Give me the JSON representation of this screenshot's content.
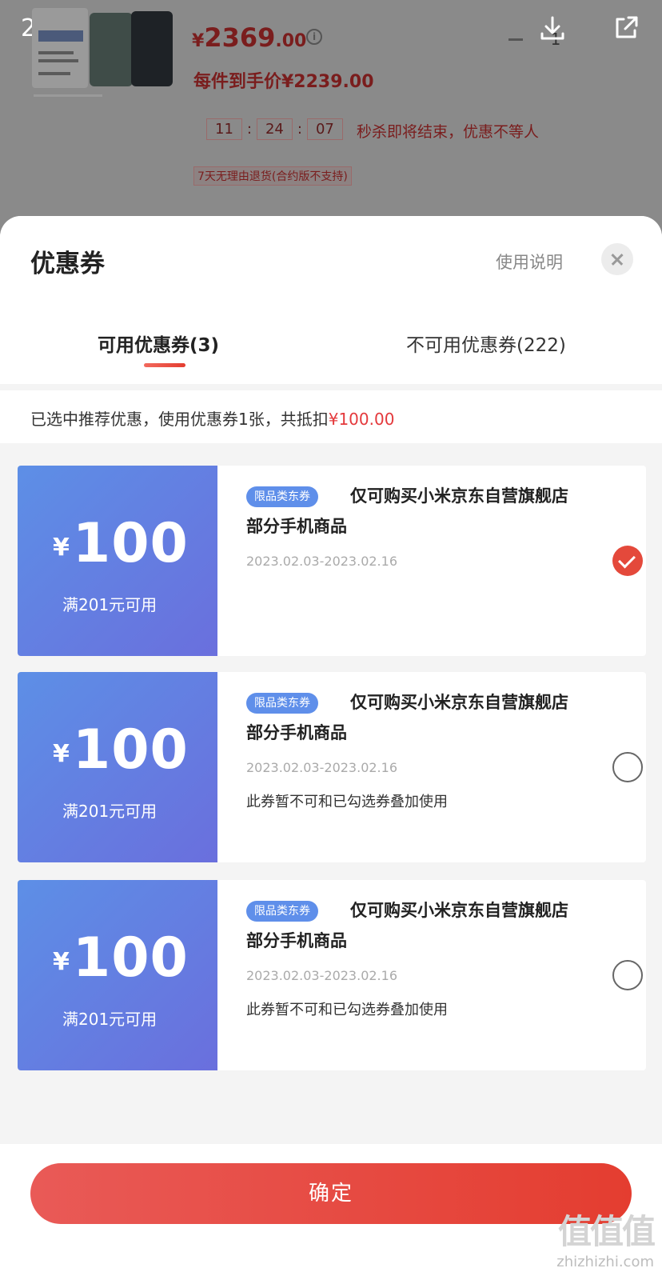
{
  "top": {
    "page_indicator": "2/2",
    "price_currency": "¥",
    "price_int": "2369",
    "price_dec": ".00",
    "info_icon": "info-icon",
    "quantity": "1",
    "unit_price": "每件到手价¥2239.00",
    "countdown": {
      "h": "11",
      "m": "24",
      "s": "07"
    },
    "countdown_text": "秒杀即将结束，优惠不等人",
    "return_note": "7天无理由退货(合约版不支持)"
  },
  "sheet": {
    "title": "优惠券",
    "help_link": "使用说明",
    "tabs": [
      {
        "label": "可用优惠券(3)"
      },
      {
        "label": "不可用优惠券(222)"
      }
    ],
    "summary_prefix": "已选中推荐优惠，使用优惠券1张，共抵扣",
    "summary_amount": "¥100.00"
  },
  "coupons": [
    {
      "currency": "¥",
      "amount": "100",
      "condition": "满201元可用",
      "tag": "限品类东券",
      "title_line1": "仅可购买小米京东自营旗舰店",
      "title_line2": "部分手机商品",
      "date": "2023.02.03-2023.02.16",
      "note": "",
      "checked": true
    },
    {
      "currency": "¥",
      "amount": "100",
      "condition": "满201元可用",
      "tag": "限品类东券",
      "title_line1": "仅可购买小米京东自营旗舰店",
      "title_line2": "部分手机商品",
      "date": "2023.02.03-2023.02.16",
      "note": "此券暂不可和已勾选券叠加使用",
      "checked": false
    },
    {
      "currency": "¥",
      "amount": "100",
      "condition": "满201元可用",
      "tag": "限品类东券",
      "title_line1": "仅可购买小米京东自营旗舰店",
      "title_line2": "部分手机商品",
      "date": "2023.02.03-2023.02.16",
      "note": "此券暂不可和已勾选券叠加使用",
      "checked": false
    }
  ],
  "footer": {
    "confirm_label": "确定",
    "watermark_logo": "值值值",
    "watermark_url": "zhizhizhi.com"
  },
  "colors": {
    "accent_red": "#e4393c",
    "coupon_blue": "#5d8fe6"
  }
}
